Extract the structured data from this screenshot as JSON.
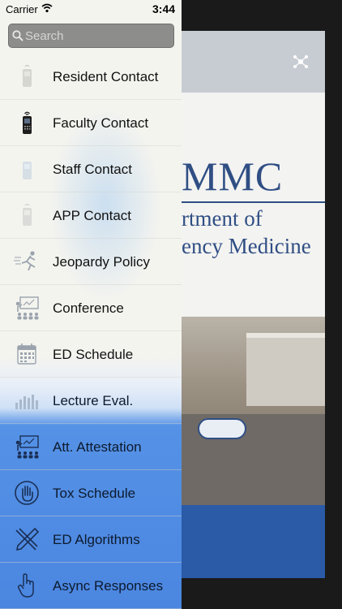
{
  "status_bar": {
    "carrier": "Carrier",
    "time": "3:44 P"
  },
  "search": {
    "placeholder": "Search"
  },
  "menu": {
    "items": [
      {
        "label": "Resident Contact",
        "icon": "cellphone-faded-icon"
      },
      {
        "label": "Faculty Contact",
        "icon": "cellphone-icon"
      },
      {
        "label": "Staff Contact",
        "icon": "cellphone-faded-icon"
      },
      {
        "label": "APP Contact",
        "icon": "cellphone-faded-icon"
      },
      {
        "label": "Jeopardy Policy",
        "icon": "runner-icon"
      },
      {
        "label": "Conference",
        "icon": "presentation-icon"
      },
      {
        "label": "ED Schedule",
        "icon": "calendar-icon"
      },
      {
        "label": "Lecture Eval.",
        "icon": "bars-icon"
      },
      {
        "label": "Att. Attestation",
        "icon": "presentation-icon"
      },
      {
        "label": "Tox Schedule",
        "icon": "hand-icon"
      },
      {
        "label": "ED Algorithms",
        "icon": "tools-icon"
      },
      {
        "label": "Async Responses",
        "icon": "pointer-hand-icon"
      }
    ]
  },
  "background": {
    "logo_text": "MMC",
    "dept_line1": "rtment of",
    "dept_line2": "ency Medicine"
  },
  "colors": {
    "drawer": "#f4f4ef",
    "drawer_blue": "#4b86e0",
    "brand_blue": "#2f4e84"
  }
}
